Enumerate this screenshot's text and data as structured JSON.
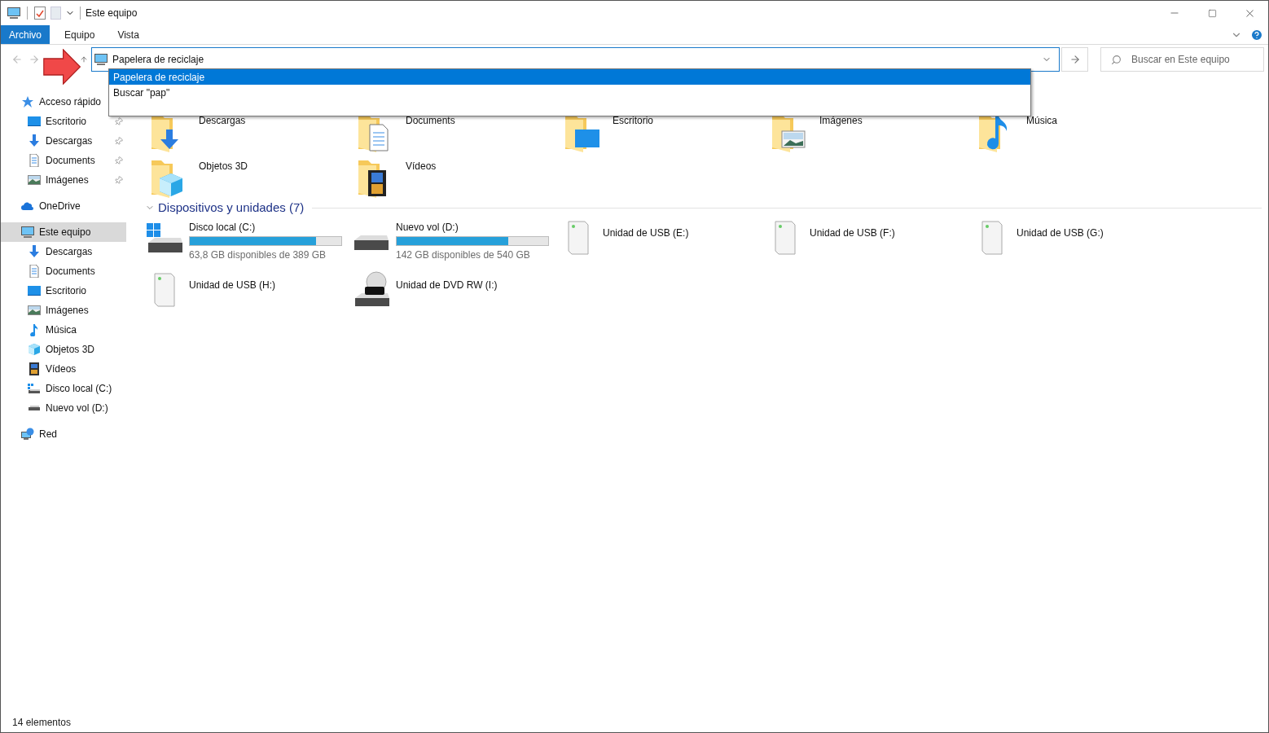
{
  "window": {
    "title": "Este equipo"
  },
  "ribbon_tabs": [
    {
      "label": "Archivo",
      "selected": true
    },
    {
      "label": "Equipo",
      "selected": false
    },
    {
      "label": "Vista",
      "selected": false
    }
  ],
  "address": {
    "value": "Papelera de reciclaje",
    "suggestions": [
      {
        "label": "Papelera de reciclaje",
        "selected": true
      },
      {
        "label": "Buscar \"pap\"",
        "selected": false
      }
    ]
  },
  "search": {
    "placeholder": "Buscar en Este equipo"
  },
  "sidebar": {
    "items": [
      {
        "label": "Acceso rápido",
        "kind": "star",
        "selected": false,
        "children": [
          {
            "label": "Escritorio",
            "kind": "desktop",
            "selected": false,
            "pinned": true
          },
          {
            "label": "Descargas",
            "kind": "download",
            "selected": false,
            "pinned": true
          },
          {
            "label": "Documents",
            "kind": "document",
            "selected": false,
            "pinned": true
          },
          {
            "label": "Imágenes",
            "kind": "pictures",
            "selected": false,
            "pinned": true
          }
        ]
      },
      {
        "label": "OneDrive",
        "kind": "cloud",
        "selected": false
      },
      {
        "label": "Este equipo",
        "kind": "computer",
        "selected": true,
        "children": [
          {
            "label": "Descargas",
            "kind": "download",
            "selected": false
          },
          {
            "label": "Documents",
            "kind": "document",
            "selected": false
          },
          {
            "label": "Escritorio",
            "kind": "desktop",
            "selected": false
          },
          {
            "label": "Imágenes",
            "kind": "pictures",
            "selected": false
          },
          {
            "label": "Música",
            "kind": "music",
            "selected": false
          },
          {
            "label": "Objetos 3D",
            "kind": "cube",
            "selected": false
          },
          {
            "label": "Vídeos",
            "kind": "video",
            "selected": false
          },
          {
            "label": "Disco local (C:)",
            "kind": "windrive",
            "selected": false
          },
          {
            "label": "Nuevo vol (D:)",
            "kind": "drive",
            "selected": false
          }
        ]
      },
      {
        "label": "Red",
        "kind": "network",
        "selected": false
      }
    ]
  },
  "folders": [
    {
      "name": "Descargas",
      "kind": "download"
    },
    {
      "name": "Documents",
      "kind": "document"
    },
    {
      "name": "Escritorio",
      "kind": "desktop"
    },
    {
      "name": "Imágenes",
      "kind": "pictures"
    },
    {
      "name": "Música",
      "kind": "music"
    },
    {
      "name": "Objetos 3D",
      "kind": "cube"
    },
    {
      "name": "Vídeos",
      "kind": "video"
    }
  ],
  "devices": {
    "title": "Dispositivos y unidades (7)",
    "items": [
      {
        "name": "Disco local (C:)",
        "kind": "windrive",
        "level": 0.836,
        "free": "63,8 GB disponibles de 389 GB"
      },
      {
        "name": "Nuevo vol (D:)",
        "kind": "drive",
        "level": 0.737,
        "free": "142 GB disponibles de 540 GB"
      },
      {
        "name": "Unidad de USB (E:)",
        "kind": "usb"
      },
      {
        "name": "Unidad de USB (F:)",
        "kind": "usb"
      },
      {
        "name": "Unidad de USB (G:)",
        "kind": "usb"
      },
      {
        "name": "Unidad de USB (H:)",
        "kind": "usb"
      },
      {
        "name": "Unidad de DVD RW (I:)",
        "kind": "dvd"
      }
    ]
  },
  "status_bar": {
    "text": "14 elementos"
  }
}
